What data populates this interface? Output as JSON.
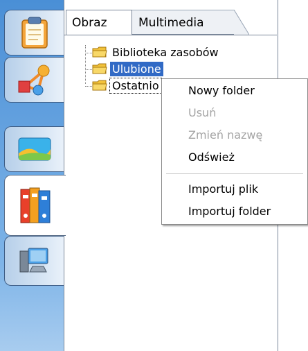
{
  "sidebar": {
    "tabs": [
      {
        "name": "clipboard",
        "icon": "clipboard-icon"
      },
      {
        "name": "shapes",
        "icon": "shapes-graph-icon"
      },
      {
        "name": "landscape",
        "icon": "landscape-icon"
      },
      {
        "name": "binders",
        "icon": "binders-icon",
        "active": true
      },
      {
        "name": "computer",
        "icon": "computer-icon"
      }
    ]
  },
  "panel": {
    "tabs": [
      {
        "label": "Obraz",
        "active": true
      },
      {
        "label": "Multimedia"
      }
    ]
  },
  "tree": {
    "items": [
      {
        "label": "Biblioteka zasobów"
      },
      {
        "label": "Ulubione",
        "selected": true
      },
      {
        "label": "Ostatnio",
        "focused": true
      }
    ]
  },
  "context_menu": {
    "items": [
      {
        "label": "Nowy folder",
        "enabled": true
      },
      {
        "label": "Usuń",
        "enabled": false
      },
      {
        "label": "Zmień nazwę",
        "enabled": false
      },
      {
        "label": "Odśwież",
        "enabled": true
      },
      {
        "label": "Importuj plik",
        "enabled": true
      },
      {
        "label": "Importuj folder",
        "enabled": true
      }
    ]
  },
  "colors": {
    "selection": "#316ac5",
    "strip_top": "#4a8fd6",
    "strip_bottom": "#a8ccef",
    "disabled_text": "#a4a4a4"
  }
}
